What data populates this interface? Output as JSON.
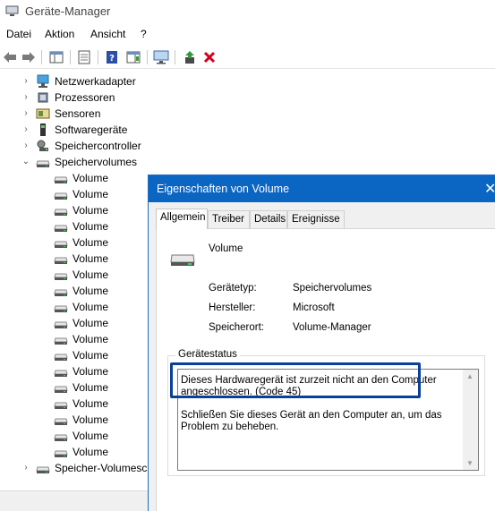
{
  "window": {
    "title": "Geräte-Manager"
  },
  "menu": [
    "Datei",
    "Aktion",
    "Ansicht",
    "?"
  ],
  "toolbar": {
    "buttons": [
      "back-icon",
      "forward-icon",
      "show-hide-console-tree-icon",
      "properties-icon",
      "help-icon",
      "action-pane-icon",
      "monitor-icon",
      "update-driver-icon",
      "uninstall-icon"
    ]
  },
  "tree": {
    "categories": [
      {
        "label": "Netzwerkadapter",
        "icon": "network-adapter-icon"
      },
      {
        "label": "Prozessoren",
        "icon": "processor-icon"
      },
      {
        "label": "Sensoren",
        "icon": "sensor-icon"
      },
      {
        "label": "Softwaregeräte",
        "icon": "software-device-icon"
      },
      {
        "label": "Speichercontroller",
        "icon": "storage-controller-icon"
      },
      {
        "label": "Speichervolumes",
        "icon": "drive-icon"
      }
    ],
    "volumes": [
      "Volume",
      "Volume",
      "Volume",
      "Volume",
      "Volume",
      "Volume",
      "Volume",
      "Volume",
      "Volume",
      "Volume",
      "Volume",
      "Volume",
      "Volume",
      "Volume",
      "Volume",
      "Volume",
      "Volume",
      "Volume"
    ],
    "last_item": "Speicher-Volumesch"
  },
  "dialog": {
    "title": "Eigenschaften von Volume",
    "close": "✕",
    "tabs": [
      "Allgemein",
      "Treiber",
      "Details",
      "Ereignisse"
    ],
    "device_name": "Volume",
    "props": [
      {
        "label": "Gerätetyp:",
        "value": "Speichervolumes"
      },
      {
        "label": "Hersteller:",
        "value": "Microsoft"
      },
      {
        "label": "Speicherort:",
        "value": "Volume-Manager"
      }
    ],
    "status_group_title": "Gerätestatus",
    "status_line1": "Dieses Hardwaregerät ist zurzeit nicht an den Computer angeschlossen. (Code 45)",
    "status_line2": "Schließen Sie dieses Gerät an den Computer an, um das Problem zu beheben."
  },
  "colors": {
    "dialog_title": "#0b65c2",
    "highlight": "#0a3f9a",
    "uninstall": "#d0021b"
  }
}
